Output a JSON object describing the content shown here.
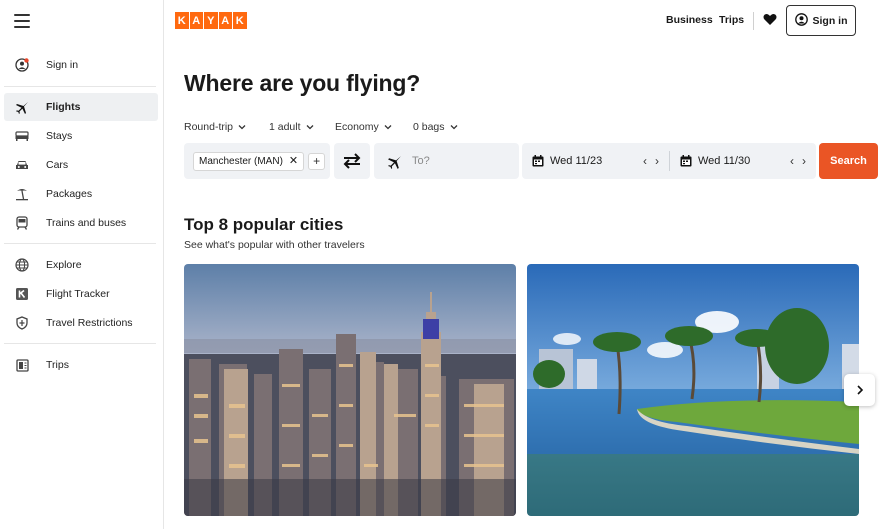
{
  "sidebar": {
    "items": [
      {
        "label": "Sign in",
        "icon": "user-alert-icon"
      },
      {
        "label": "Flights",
        "icon": "plane-icon",
        "active": true
      },
      {
        "label": "Stays",
        "icon": "bed-icon"
      },
      {
        "label": "Cars",
        "icon": "car-icon"
      },
      {
        "label": "Packages",
        "icon": "palm-icon"
      },
      {
        "label": "Trains and buses",
        "icon": "train-icon"
      },
      {
        "label": "Explore",
        "icon": "globe-icon"
      },
      {
        "label": "Flight Tracker",
        "icon": "kayak-k-icon"
      },
      {
        "label": "Travel Restrictions",
        "icon": "shield-icon"
      },
      {
        "label": "Trips",
        "icon": "trips-icon"
      }
    ]
  },
  "header": {
    "logo_letters": [
      "K",
      "A",
      "Y",
      "A",
      "K"
    ],
    "business": "Business",
    "trips": "Trips",
    "signin": "Sign in"
  },
  "search": {
    "title": "Where are you flying?",
    "options": {
      "trip_type": "Round-trip",
      "travelers": "1 adult",
      "cabin": "Economy",
      "bags": "0 bags"
    },
    "origin": "Manchester (MAN)",
    "destination_placeholder": "To?",
    "depart": "Wed 11/23",
    "return": "Wed 11/30",
    "button": "Search"
  },
  "popular": {
    "title": "Top 8 popular cities",
    "subtitle": "See what's popular with other travelers"
  },
  "colors": {
    "brand": "#ff690f",
    "search_button": "#ea5525",
    "field_bg": "#f0f2f5"
  }
}
